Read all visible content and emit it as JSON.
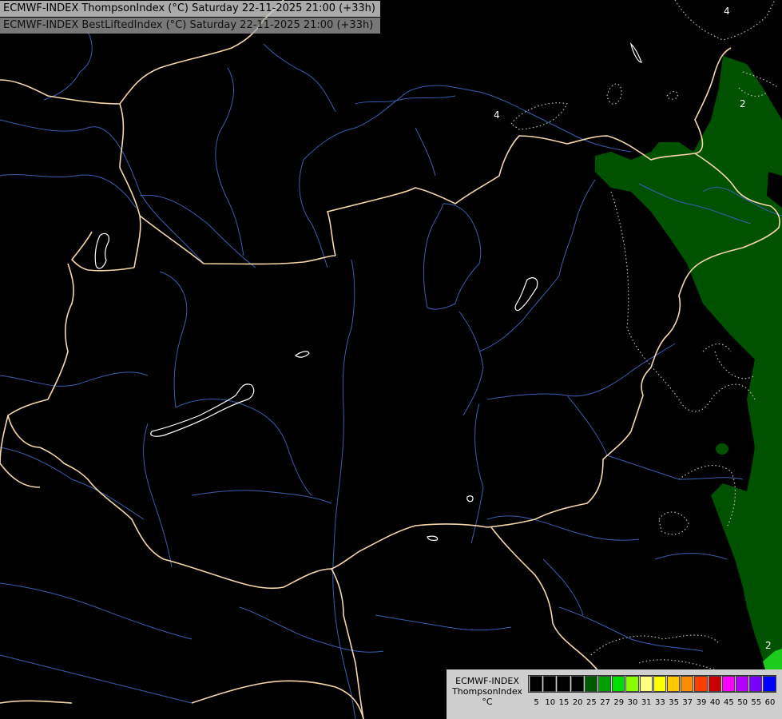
{
  "titles": {
    "line1": "ECMWF-INDEX ThompsonIndex (°C) Saturday 22-11-2025 21:00 (+33h)",
    "line2": "ECMWF-INDEX BestLiftedIndex (°C) Saturday 22-11-2025 21:00 (+33h)"
  },
  "contour_labels": [
    "4",
    "2",
    "4",
    "2",
    "2"
  ],
  "legend": {
    "line1": "ECMWF-INDEX",
    "line2": "ThompsonIndex",
    "unit": "°C",
    "ticks": [
      "5",
      "10",
      "15",
      "20",
      "25",
      "27",
      "29",
      "30",
      "31",
      "33",
      "35",
      "37",
      "39",
      "40",
      "45",
      "50",
      "55",
      "60"
    ],
    "colors": [
      "#000000",
      "#000000",
      "#000000",
      "#000000",
      "#005a00",
      "#00a000",
      "#00e000",
      "#88ff00",
      "#ffff80",
      "#ffff00",
      "#ffc800",
      "#ff8c00",
      "#ff3c00",
      "#c80000",
      "#ff00ff",
      "#b400ff",
      "#7800ff",
      "#0000ff"
    ]
  },
  "colors": {
    "border": "#f5d7a8",
    "river": "#3a5fb0",
    "field_dark": "#005200",
    "field_mid": "#007400",
    "field_bright": "#1ccc1c"
  }
}
